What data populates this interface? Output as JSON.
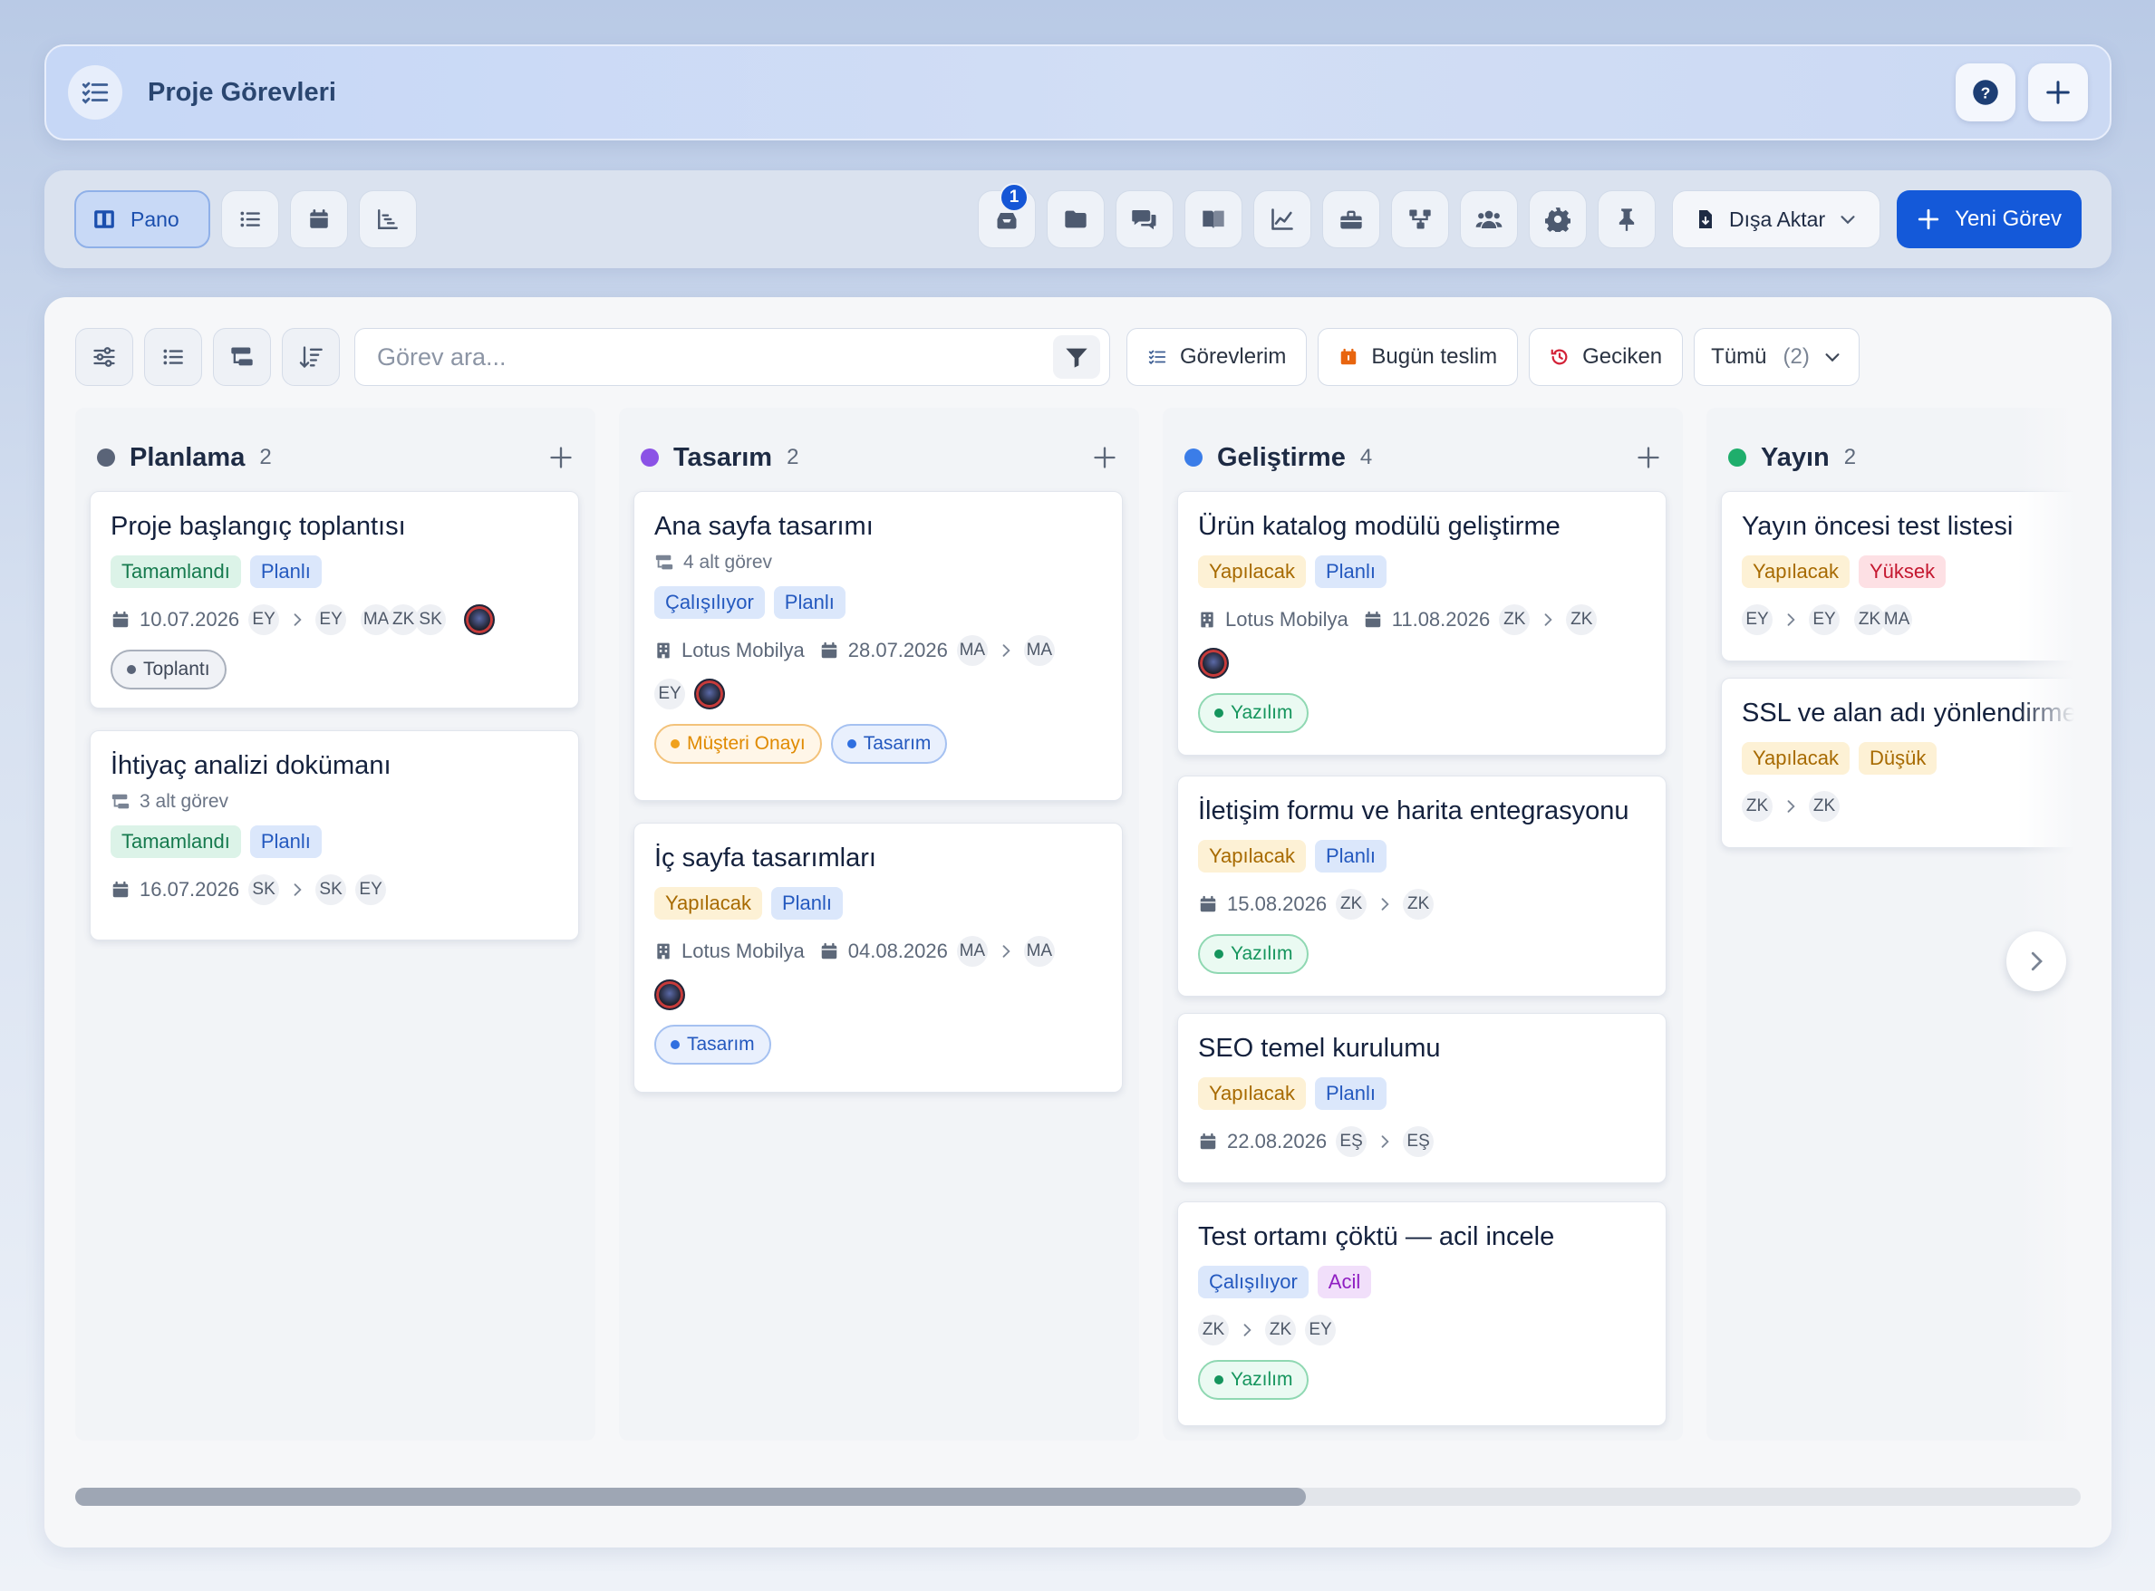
{
  "header": {
    "title": "Proje Görevleri"
  },
  "toolbar": {
    "view_label": "Pano",
    "badge_count": "1",
    "export_label": "Dışa Aktar",
    "new_task_label": "Yeni Görev"
  },
  "filters": {
    "search_placeholder": "Görev ara...",
    "my_tasks": "Görevlerim",
    "due_today": "Bugün teslim",
    "overdue": "Geciken",
    "all_label": "Tümü",
    "all_count": "(2)"
  },
  "columns": [
    {
      "name": "Planlama",
      "count": "2",
      "color": "#5a6478",
      "cards": [
        {
          "title": "Proje başlangıç toplantısı",
          "status": "Tamamlandı",
          "type": "Planlı",
          "date": "10.07.2026",
          "from": "EY",
          "to": "EY",
          "assignees": [
            "MA",
            "ZK",
            "SK"
          ],
          "label": "Toplantı"
        },
        {
          "title": "İhtiyaç analizi dokümanı",
          "subtasks": "3 alt görev",
          "status": "Tamamlandı",
          "type": "Planlı",
          "date": "16.07.2026",
          "from": "SK",
          "to": "SK",
          "assignees": [
            "EY"
          ]
        }
      ]
    },
    {
      "name": "Tasarım",
      "count": "2",
      "color": "#8b52e6",
      "cards": [
        {
          "title": "Ana sayfa tasarımı",
          "subtasks": "4 alt görev",
          "status": "Çalışılıyor",
          "type": "Planlı",
          "company": "Lotus Mobilya",
          "date": "28.07.2026",
          "from": "MA",
          "to": "MA",
          "assignees": [
            "EY"
          ],
          "labels": [
            "Müşteri Onayı",
            "Tasarım"
          ]
        },
        {
          "title": "İç sayfa tasarımları",
          "status": "Yapılacak",
          "type": "Planlı",
          "company": "Lotus Mobilya",
          "date": "04.08.2026",
          "from": "MA",
          "to": "MA",
          "label": "Tasarım"
        }
      ]
    },
    {
      "name": "Geliştirme",
      "count": "4",
      "color": "#3b7de8",
      "cards": [
        {
          "title": "Ürün katalog modülü geliştirme",
          "status": "Yapılacak",
          "type": "Planlı",
          "company": "Lotus Mobilya",
          "date": "11.08.2026",
          "from": "ZK",
          "to": "ZK",
          "label": "Yazılım"
        },
        {
          "title": "İletişim formu ve harita entegrasyonu",
          "status": "Yapılacak",
          "type": "Planlı",
          "date": "15.08.2026",
          "from": "ZK",
          "to": "ZK",
          "label": "Yazılım"
        },
        {
          "title": "SEO temel kurulumu",
          "status": "Yapılacak",
          "type": "Planlı",
          "date": "22.08.2026",
          "from": "EŞ",
          "to": "EŞ"
        },
        {
          "title": "Test ortamı çöktü — acil incele",
          "status": "Çalışılıyor",
          "type": "Acil",
          "from": "ZK",
          "to": "ZK",
          "assignees": [
            "EY"
          ],
          "label": "Yazılım"
        }
      ]
    },
    {
      "name": "Yayın",
      "count": "2",
      "color": "#1fae6c",
      "cards": [
        {
          "title": "Yayın öncesi test listesi",
          "status": "Yapılacak",
          "type": "Yüksek",
          "from": "EY",
          "to": "EY",
          "assignees": [
            "ZK",
            "MA"
          ]
        },
        {
          "title": "SSL ve alan adı yönlendirme",
          "status": "Yapılacak",
          "type": "Düşük",
          "from": "ZK",
          "to": "ZK"
        }
      ]
    }
  ],
  "icons": {
    "header": "task-list-icon",
    "help": "help-icon",
    "add": "plus-icon",
    "views": [
      "board-icon",
      "list-icon",
      "calendar-icon",
      "gantt-icon"
    ],
    "tools": [
      "inbox-icon",
      "folder-icon",
      "chat-icon",
      "book-icon",
      "chart-icon",
      "toolbox-icon",
      "hierarchy-icon",
      "team-icon",
      "gear-icon",
      "pin-icon"
    ],
    "accent": "#1459d9"
  }
}
